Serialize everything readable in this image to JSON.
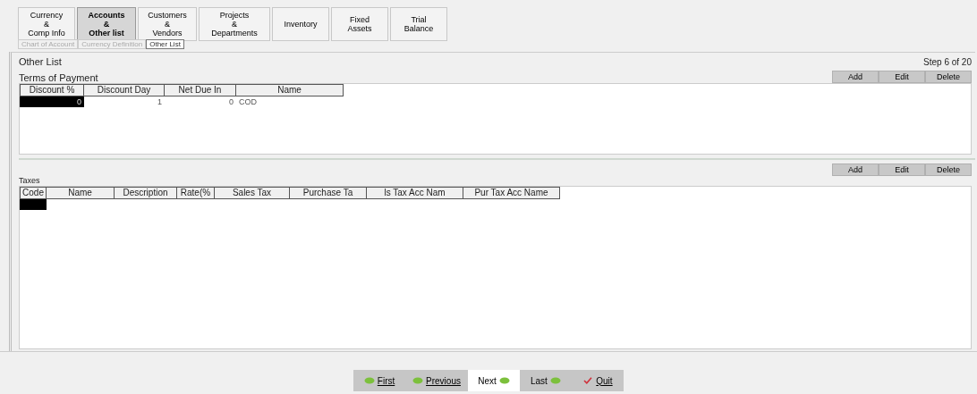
{
  "tabs": [
    {
      "lines": [
        "Currency",
        "&",
        "Comp Info"
      ],
      "selected": false
    },
    {
      "lines": [
        "Accounts",
        "&",
        "Other list"
      ],
      "selected": true
    },
    {
      "lines": [
        "Customers",
        "&",
        "Vendors"
      ],
      "selected": false
    },
    {
      "lines": [
        "Projects",
        "&",
        "Departments"
      ],
      "selected": false
    },
    {
      "lines": [
        "Inventory"
      ],
      "selected": false
    },
    {
      "lines": [
        "Fixed",
        "Assets"
      ],
      "selected": false
    },
    {
      "lines": [
        "Trial",
        "Balance"
      ],
      "selected": false
    }
  ],
  "subtabs": [
    {
      "label": "Chart of Account",
      "selected": false
    },
    {
      "label": "Currency Definition",
      "selected": false
    },
    {
      "label": "Other List",
      "selected": true
    }
  ],
  "page_title": "Other List",
  "step": "Step 6 of 20",
  "terms": {
    "title": "Terms of Payment",
    "buttons": [
      "Add",
      "Edit",
      "Delete"
    ],
    "columns": [
      "Discount %",
      "Discount Day",
      "Net Due In",
      "Name"
    ],
    "rows": [
      {
        "cells": [
          {
            "text": "0",
            "selected": true
          },
          {
            "text": "1",
            "selected": false
          },
          {
            "text": "0",
            "selected": false
          },
          {
            "text": "COD",
            "selected": false
          }
        ]
      }
    ]
  },
  "taxes": {
    "title": "Taxes",
    "buttons": [
      "Add",
      "Edit",
      "Delete"
    ],
    "columns": [
      "Code",
      "Name",
      "Description",
      "Rate(%",
      "Sales Tax",
      "Purchase Ta",
      "ls Tax Acc Nam",
      "Pur Tax Acc Name"
    ],
    "cursor_row": true
  },
  "nav": [
    {
      "label": "First",
      "kind": "back",
      "underlined": true,
      "selected": false
    },
    {
      "label": "Previous",
      "kind": "back",
      "underlined": true,
      "selected": false
    },
    {
      "label": "Next",
      "kind": "forward",
      "underlined": false,
      "selected": true
    },
    {
      "label": "Last",
      "kind": "forward",
      "underlined": false,
      "selected": false
    },
    {
      "label": "Quit",
      "kind": "quit",
      "underlined": true,
      "selected": false
    }
  ]
}
